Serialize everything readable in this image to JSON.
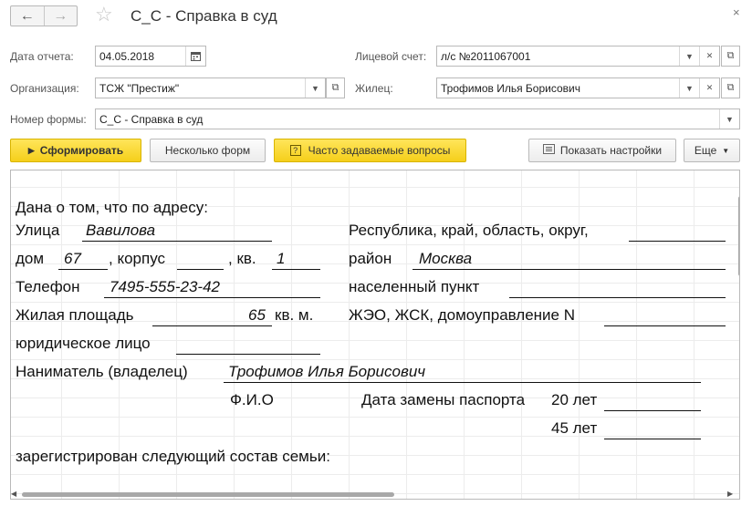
{
  "window": {
    "title": "С_С - Справка в суд",
    "back_icon": "arrow-left-icon",
    "forward_icon": "arrow-right-icon",
    "favorite_icon": "star-icon",
    "close_glyph": "×"
  },
  "form": {
    "report_date_label": "Дата отчета:",
    "report_date_value": "04.05.2018",
    "account_label": "Лицевой счет:",
    "account_value": "л/с №2011067001",
    "organization_label": "Организация:",
    "organization_value": "ТСЖ \"Престиж\"",
    "resident_label": "Жилец:",
    "resident_value": "Трофимов Илья Борисович",
    "form_number_label": "Номер формы:",
    "form_number_value": "С_С - Справка в суд"
  },
  "toolbar": {
    "generate_label": "Сформировать",
    "several_forms_label": "Несколько форм",
    "faq_label": "Часто задаваемые вопросы",
    "show_settings_label": "Показать настройки",
    "more_label": "Еще"
  },
  "document": {
    "intro": "Дана о том, что по адресу:",
    "street_label": "Улица",
    "street_value": "Вавилова",
    "region_label": "Республика, край, область, округ,",
    "house_label": "дом",
    "house_value": "67",
    "building_label": ", корпус",
    "apartment_label": ", кв.",
    "apartment_value": "1",
    "district_label": "район",
    "district_value": "Москва",
    "phone_label": "Телефон",
    "phone_value": "7495-555-23-42",
    "locality_label": "населенный пункт",
    "area_label": "Жилая площадь",
    "area_value": "65",
    "area_unit": "кв. м.",
    "housing_org_label": "ЖЭО, ЖСК, домоуправление N",
    "legal_entity_label": "юридическое лицо",
    "tenant_label": "Наниматель (владелец)",
    "tenant_value": "Трофимов Илья Борисович",
    "fio_label": "Ф.И.О",
    "passport_label": "Дата замены паспорта",
    "passport_age_1": "20 лет",
    "passport_age_2": "45 лет",
    "family_label": "зарегистрирован следующий состав семьи:"
  }
}
